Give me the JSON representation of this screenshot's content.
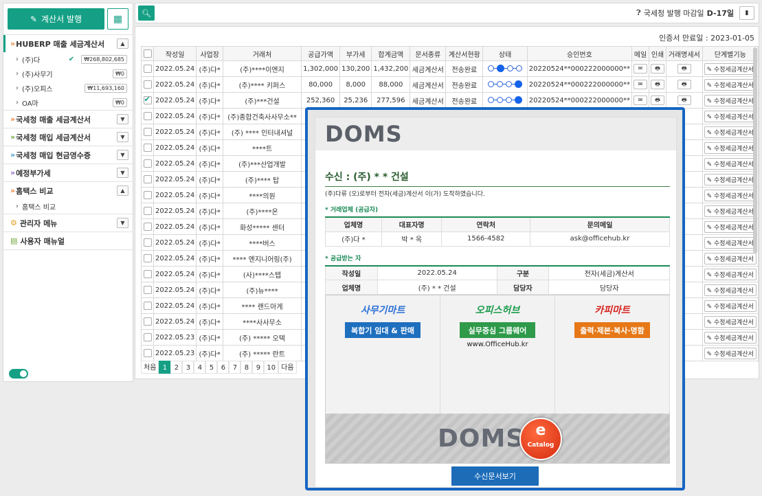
{
  "sidebar": {
    "issue_label": "계산서 발행",
    "huberp": {
      "label": "HUBERP 매출 세금계산서",
      "items": [
        {
          "label": "(주)다",
          "amount": "₩268,802,685",
          "checked": true
        },
        {
          "label": "(주)사무기",
          "amount": "₩0"
        },
        {
          "label": "(주)오피스",
          "amount": "₩11,693,160"
        },
        {
          "label": "OA마",
          "amount": "₩0"
        }
      ]
    },
    "menus": [
      "국세청 매출 세금계산서",
      "국세청 매입 세금계산서",
      "국세청 매입 현금영수증",
      "예정부가세"
    ],
    "hometax": {
      "label": "홈택스 비교",
      "sub": "홈택스 비교"
    },
    "admin": "관리자 메뉴",
    "manual": "사용자 매뉴얼"
  },
  "topbar": {
    "deadline_prefix": "국세청 발행 마감일",
    "deadline_day": "D-17일"
  },
  "main": {
    "cert_expiry": "인증서 만료일 : 2023-01-05",
    "headers": [
      "작성일",
      "사업장",
      "거래처",
      "공급가액",
      "부가세",
      "합계금액",
      "문서종류",
      "계산서현황",
      "상태",
      "승인번호",
      "메일",
      "인쇄",
      "거래명세서",
      "단계별기능"
    ],
    "rows": [
      {
        "date": "2022.05.24",
        "biz": "(주)다*",
        "client": "(주)****이엔지",
        "supply": "1,302,000",
        "vat": "130,200",
        "total": "1,432,200",
        "doc": "세금계산서",
        "status": "전송완료",
        "step": 1,
        "approval": "20220524**000222000000**",
        "checked": false
      },
      {
        "date": "2022.05.24",
        "biz": "(주)다*",
        "client": "(주)**** 키퍼스",
        "supply": "80,000",
        "vat": "8,000",
        "total": "88,000",
        "doc": "세금계산서",
        "status": "전송완료",
        "step": 3,
        "approval": "20220524**000222000000**",
        "checked": false
      },
      {
        "date": "2022.05.24",
        "biz": "(주)다*",
        "client": "(주)***건설",
        "supply": "252,360",
        "vat": "25,236",
        "total": "277,596",
        "doc": "세금계산서",
        "status": "전송완료",
        "step": 3,
        "approval": "20220524**000222000000**",
        "checked": true
      },
      {
        "date": "2022.05.24",
        "biz": "(주)다*",
        "client": "(주)종합건축사사무소**"
      },
      {
        "date": "2022.05.24",
        "biz": "(주)다*",
        "client": "(주) **** 인터내셔널"
      },
      {
        "date": "2022.05.24",
        "biz": "(주)다*",
        "client": "****트"
      },
      {
        "date": "2022.05.24",
        "biz": "(주)다*",
        "client": "(주)***산업개발"
      },
      {
        "date": "2022.05.24",
        "biz": "(주)다*",
        "client": "(주)**** 탑"
      },
      {
        "date": "2022.05.24",
        "biz": "(주)다*",
        "client": "****의원"
      },
      {
        "date": "2022.05.24",
        "biz": "(주)다*",
        "client": "(주)****온"
      },
      {
        "date": "2022.05.24",
        "biz": "(주)다*",
        "client": "화성***** 센터"
      },
      {
        "date": "2022.05.24",
        "biz": "(주)다*",
        "client": "****버스"
      },
      {
        "date": "2022.05.24",
        "biz": "(주)다*",
        "client": "**** 엔지니어링(주)"
      },
      {
        "date": "2022.05.24",
        "biz": "(주)다*",
        "client": "(사)****스텝"
      },
      {
        "date": "2022.05.24",
        "biz": "(주)다*",
        "client": "(주)뉴****"
      },
      {
        "date": "2022.05.24",
        "biz": "(주)다*",
        "client": "**** 랜드아게"
      },
      {
        "date": "2022.05.24",
        "biz": "(주)다*",
        "client": "****사사무소"
      },
      {
        "date": "2022.05.23",
        "biz": "(주)다*",
        "client": "(주) ***** 오텍"
      },
      {
        "date": "2022.05.23",
        "biz": "(주)다*",
        "client": "(주) ***** 란트"
      }
    ],
    "mail_icon": "✉",
    "print_icon": "🖶",
    "edit_label": "수정세금계산서",
    "pager": [
      "처음",
      "1",
      "2",
      "3",
      "4",
      "5",
      "6",
      "7",
      "8",
      "9",
      "10",
      "다음"
    ]
  },
  "popup": {
    "logo": "DOMS",
    "recipient": "수신 : (주) * * 건설",
    "note": "(주)다류 (오)로부터 전자(세금)계산서 이(가) 도착하였습니다.",
    "supplier_title": "* 거래업체 (공급자)",
    "supplier_headers": [
      "업체명",
      "대표자명",
      "연락처",
      "문의메일"
    ],
    "supplier_values": [
      "(주)다 *",
      "박 * 옥",
      "1566-4582",
      "ask@officehub.kr"
    ],
    "receiver_title": "* 공급받는 자",
    "receiver": {
      "written_label": "작성일",
      "written": "2022.05.24",
      "type_label": "구분",
      "type": "전자(세금)계산서",
      "company_label": "업체명",
      "company": "(주) * * 건설",
      "manager_label": "담당자",
      "manager": "담당자"
    },
    "banner": {
      "cols": [
        {
          "title": "사무기마트",
          "pill": "복합기 임대 & 판매",
          "title_color": "#2a6fd6",
          "pill_color": "#1f6fbf"
        },
        {
          "title": "오피스허브",
          "pill": "실무중심 그룹웨어",
          "url": "www.OfficeHub.kr",
          "title_color": "#1a9a4a",
          "pill_color": "#2e9a4a"
        },
        {
          "title": "카피마트",
          "pill": "출력·제본·복사·명함",
          "title_color": "#d6241f",
          "pill_color": "#e67817"
        }
      ],
      "brand": "DOMS",
      "ecat_e": "e",
      "ecat_label": "Catalog"
    },
    "view_button": "수신문서보기"
  }
}
